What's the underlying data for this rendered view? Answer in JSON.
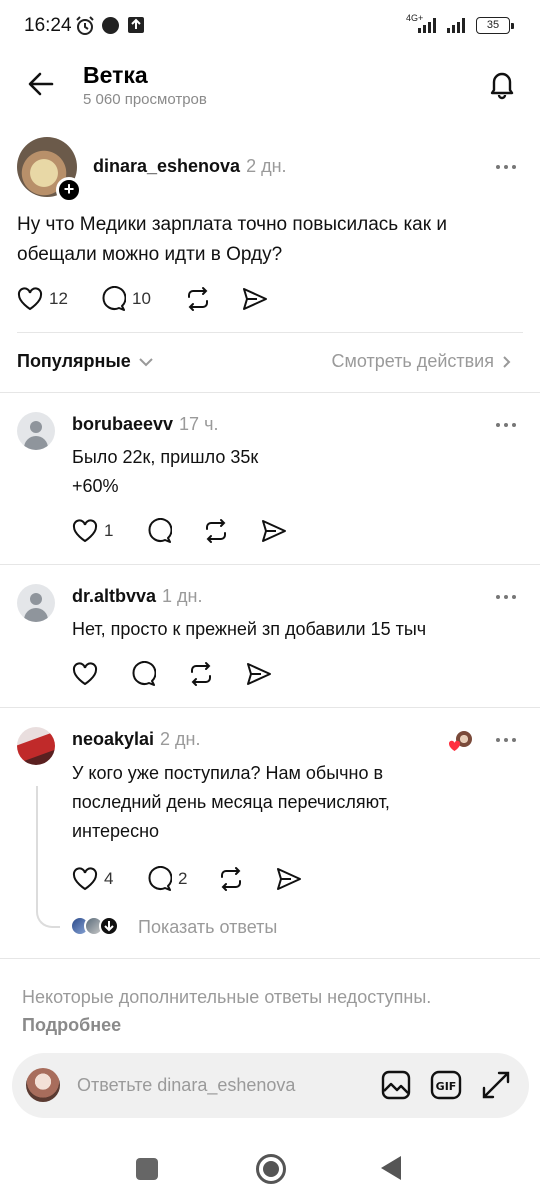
{
  "status_bar": {
    "time": "16:24",
    "network": "4G+",
    "battery": "35"
  },
  "header": {
    "title": "Ветка",
    "views": "5 060 просмотров"
  },
  "post": {
    "author": "dinara_eshenova",
    "time": "2 дн.",
    "text": "Ну что Медики зарплата точно повысилась как и обещали можно идти в Орду?",
    "likes": "12",
    "comments": "10"
  },
  "sort": {
    "label": "Популярные",
    "view_actions": "Смотреть действия"
  },
  "replies": [
    {
      "author": "borubaeevv",
      "time": "17 ч.",
      "text_lines": [
        "Было 22к, пришло 35к",
        "+60%"
      ],
      "likes": "1",
      "comments": ""
    },
    {
      "author": "dr.altbvva",
      "time": "1 дн.",
      "text_lines": [
        "Нет, просто к прежней зп добавили 15 тыч"
      ],
      "likes": "",
      "comments": ""
    },
    {
      "author": "neoakylai",
      "time": "2 дн.",
      "text_lines": [
        "У кого уже поступила? Нам обычно в",
        "последний день месяца перечисляют,",
        "интересно"
      ],
      "likes": "4",
      "comments": "2"
    }
  ],
  "show_replies": "Показать ответы",
  "unavailable": {
    "text": "Некоторые дополнительные ответы недоступны.",
    "link": "Подробнее"
  },
  "reply_bar": {
    "placeholder": "Ответьте dinara_eshenova"
  },
  "colors": {
    "muted": "#9a9a9a",
    "divider": "#e6e6e6",
    "heart_red": "#ff3040"
  }
}
